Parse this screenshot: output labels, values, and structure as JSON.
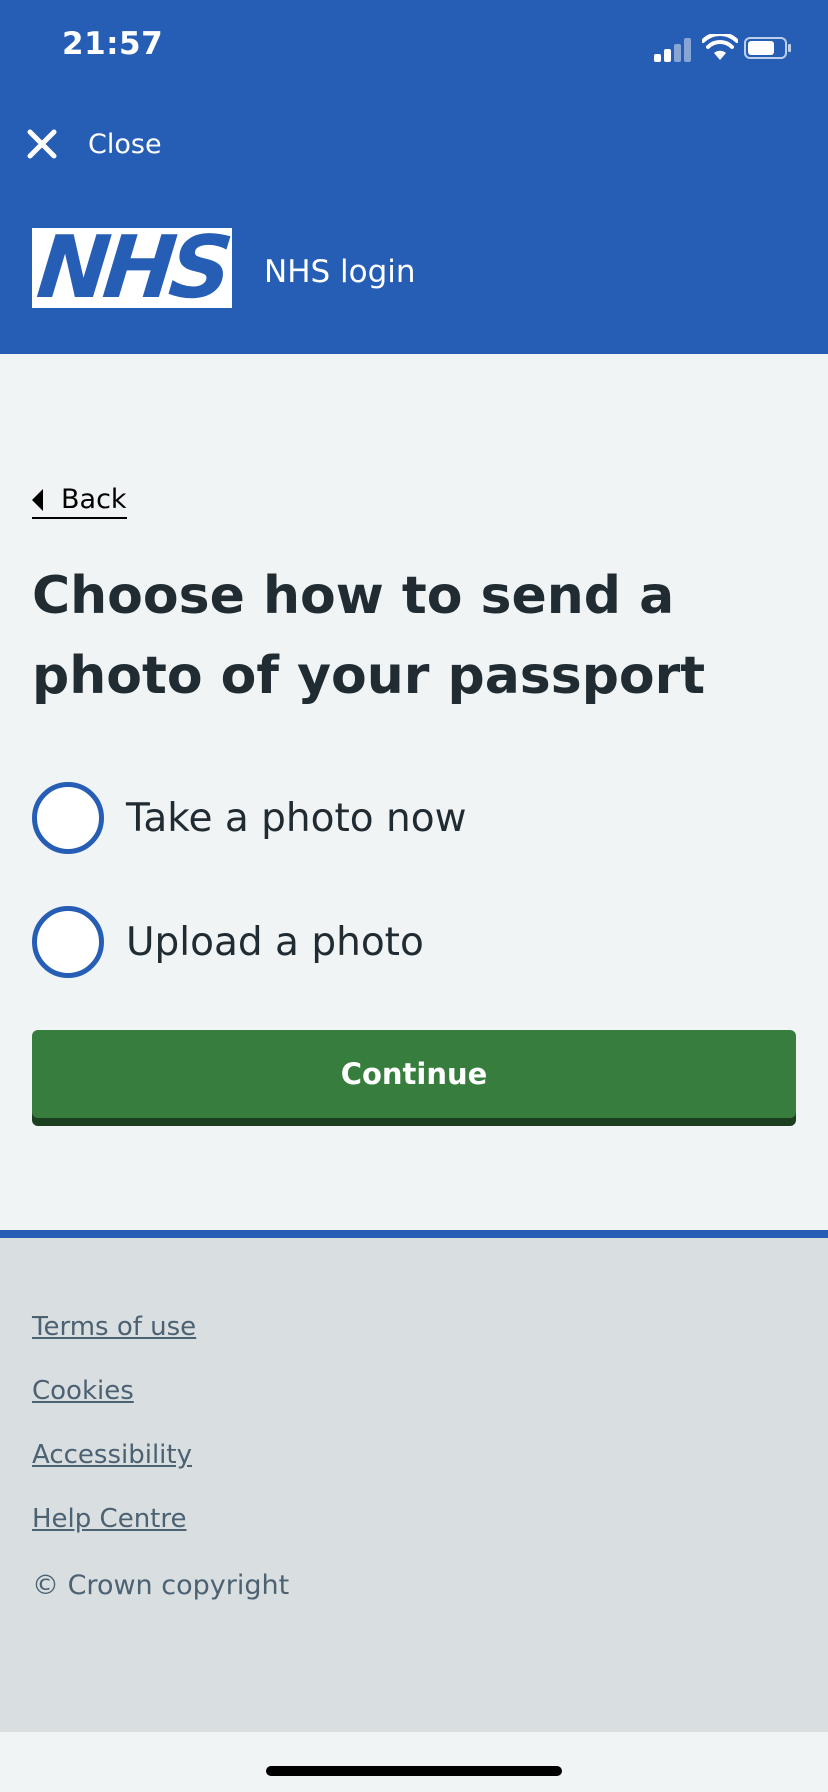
{
  "status_bar": {
    "time": "21:57"
  },
  "top_bar": {
    "close_label": "Close"
  },
  "brand": {
    "logo_text": "NHS",
    "label": "NHS login"
  },
  "nav": {
    "back_label": "Back"
  },
  "page": {
    "title": "Choose how to send a photo of your passport",
    "options": [
      {
        "label": "Take a photo now",
        "selected": false
      },
      {
        "label": "Upload a photo",
        "selected": false
      }
    ],
    "continue_label": "Continue"
  },
  "footer": {
    "links": [
      "Terms of use",
      "Cookies",
      "Accessibility",
      "Help Centre"
    ],
    "copyright": "© Crown copyright"
  },
  "colors": {
    "nhs_blue": "#265eb5",
    "button_green": "#377e3e",
    "page_background": "#f0f4f5",
    "footer_background": "#d9dee1"
  }
}
